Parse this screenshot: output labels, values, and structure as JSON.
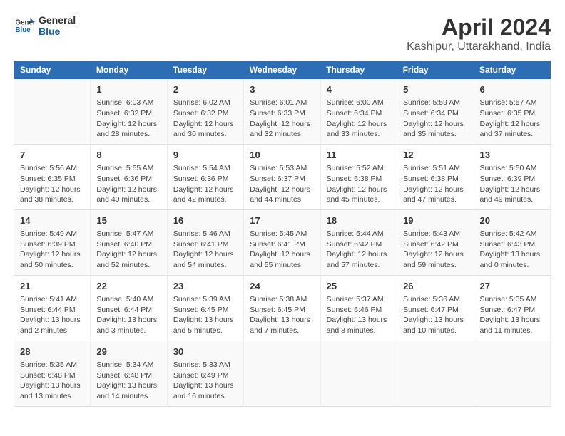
{
  "header": {
    "logo_general": "General",
    "logo_blue": "Blue",
    "title": "April 2024",
    "subtitle": "Kashipur, Uttarakhand, India"
  },
  "columns": [
    "Sunday",
    "Monday",
    "Tuesday",
    "Wednesday",
    "Thursday",
    "Friday",
    "Saturday"
  ],
  "weeks": [
    [
      {
        "day": "",
        "info": ""
      },
      {
        "day": "1",
        "info": "Sunrise: 6:03 AM\nSunset: 6:32 PM\nDaylight: 12 hours\nand 28 minutes."
      },
      {
        "day": "2",
        "info": "Sunrise: 6:02 AM\nSunset: 6:32 PM\nDaylight: 12 hours\nand 30 minutes."
      },
      {
        "day": "3",
        "info": "Sunrise: 6:01 AM\nSunset: 6:33 PM\nDaylight: 12 hours\nand 32 minutes."
      },
      {
        "day": "4",
        "info": "Sunrise: 6:00 AM\nSunset: 6:34 PM\nDaylight: 12 hours\nand 33 minutes."
      },
      {
        "day": "5",
        "info": "Sunrise: 5:59 AM\nSunset: 6:34 PM\nDaylight: 12 hours\nand 35 minutes."
      },
      {
        "day": "6",
        "info": "Sunrise: 5:57 AM\nSunset: 6:35 PM\nDaylight: 12 hours\nand 37 minutes."
      }
    ],
    [
      {
        "day": "7",
        "info": "Sunrise: 5:56 AM\nSunset: 6:35 PM\nDaylight: 12 hours\nand 38 minutes."
      },
      {
        "day": "8",
        "info": "Sunrise: 5:55 AM\nSunset: 6:36 PM\nDaylight: 12 hours\nand 40 minutes."
      },
      {
        "day": "9",
        "info": "Sunrise: 5:54 AM\nSunset: 6:36 PM\nDaylight: 12 hours\nand 42 minutes."
      },
      {
        "day": "10",
        "info": "Sunrise: 5:53 AM\nSunset: 6:37 PM\nDaylight: 12 hours\nand 44 minutes."
      },
      {
        "day": "11",
        "info": "Sunrise: 5:52 AM\nSunset: 6:38 PM\nDaylight: 12 hours\nand 45 minutes."
      },
      {
        "day": "12",
        "info": "Sunrise: 5:51 AM\nSunset: 6:38 PM\nDaylight: 12 hours\nand 47 minutes."
      },
      {
        "day": "13",
        "info": "Sunrise: 5:50 AM\nSunset: 6:39 PM\nDaylight: 12 hours\nand 49 minutes."
      }
    ],
    [
      {
        "day": "14",
        "info": "Sunrise: 5:49 AM\nSunset: 6:39 PM\nDaylight: 12 hours\nand 50 minutes."
      },
      {
        "day": "15",
        "info": "Sunrise: 5:47 AM\nSunset: 6:40 PM\nDaylight: 12 hours\nand 52 minutes."
      },
      {
        "day": "16",
        "info": "Sunrise: 5:46 AM\nSunset: 6:41 PM\nDaylight: 12 hours\nand 54 minutes."
      },
      {
        "day": "17",
        "info": "Sunrise: 5:45 AM\nSunset: 6:41 PM\nDaylight: 12 hours\nand 55 minutes."
      },
      {
        "day": "18",
        "info": "Sunrise: 5:44 AM\nSunset: 6:42 PM\nDaylight: 12 hours\nand 57 minutes."
      },
      {
        "day": "19",
        "info": "Sunrise: 5:43 AM\nSunset: 6:42 PM\nDaylight: 12 hours\nand 59 minutes."
      },
      {
        "day": "20",
        "info": "Sunrise: 5:42 AM\nSunset: 6:43 PM\nDaylight: 13 hours\nand 0 minutes."
      }
    ],
    [
      {
        "day": "21",
        "info": "Sunrise: 5:41 AM\nSunset: 6:44 PM\nDaylight: 13 hours\nand 2 minutes."
      },
      {
        "day": "22",
        "info": "Sunrise: 5:40 AM\nSunset: 6:44 PM\nDaylight: 13 hours\nand 3 minutes."
      },
      {
        "day": "23",
        "info": "Sunrise: 5:39 AM\nSunset: 6:45 PM\nDaylight: 13 hours\nand 5 minutes."
      },
      {
        "day": "24",
        "info": "Sunrise: 5:38 AM\nSunset: 6:45 PM\nDaylight: 13 hours\nand 7 minutes."
      },
      {
        "day": "25",
        "info": "Sunrise: 5:37 AM\nSunset: 6:46 PM\nDaylight: 13 hours\nand 8 minutes."
      },
      {
        "day": "26",
        "info": "Sunrise: 5:36 AM\nSunset: 6:47 PM\nDaylight: 13 hours\nand 10 minutes."
      },
      {
        "day": "27",
        "info": "Sunrise: 5:35 AM\nSunset: 6:47 PM\nDaylight: 13 hours\nand 11 minutes."
      }
    ],
    [
      {
        "day": "28",
        "info": "Sunrise: 5:35 AM\nSunset: 6:48 PM\nDaylight: 13 hours\nand 13 minutes."
      },
      {
        "day": "29",
        "info": "Sunrise: 5:34 AM\nSunset: 6:48 PM\nDaylight: 13 hours\nand 14 minutes."
      },
      {
        "day": "30",
        "info": "Sunrise: 5:33 AM\nSunset: 6:49 PM\nDaylight: 13 hours\nand 16 minutes."
      },
      {
        "day": "",
        "info": ""
      },
      {
        "day": "",
        "info": ""
      },
      {
        "day": "",
        "info": ""
      },
      {
        "day": "",
        "info": ""
      }
    ]
  ]
}
